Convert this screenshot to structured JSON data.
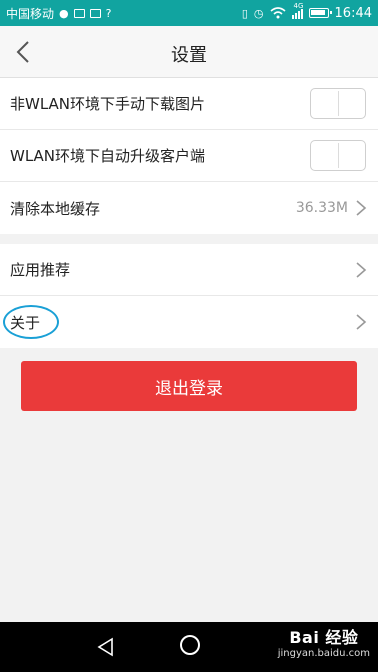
{
  "status_bar": {
    "carrier": "中国移动",
    "signal_label": "4G",
    "time": "16:44"
  },
  "header": {
    "title": "设置"
  },
  "settings": {
    "manual_download_label": "非WLAN环境下手动下载图片",
    "auto_upgrade_label": "WLAN环境下自动升级客户端",
    "clear_cache_label": "清除本地缓存",
    "cache_size": "36.33M",
    "app_recommend_label": "应用推荐",
    "about_label": "关于"
  },
  "logout": {
    "label": "退出登录"
  },
  "watermark": {
    "logo": "Bai 经验",
    "url": "jingyan.baidu.com"
  },
  "colors": {
    "status_bar": "#11a4a0",
    "logout": "#ea3a3a",
    "annotation": "#1aa0d6"
  },
  "icons": [
    "back-arrow-icon",
    "chevron-right-icon",
    "nav-back-icon",
    "nav-home-icon"
  ]
}
